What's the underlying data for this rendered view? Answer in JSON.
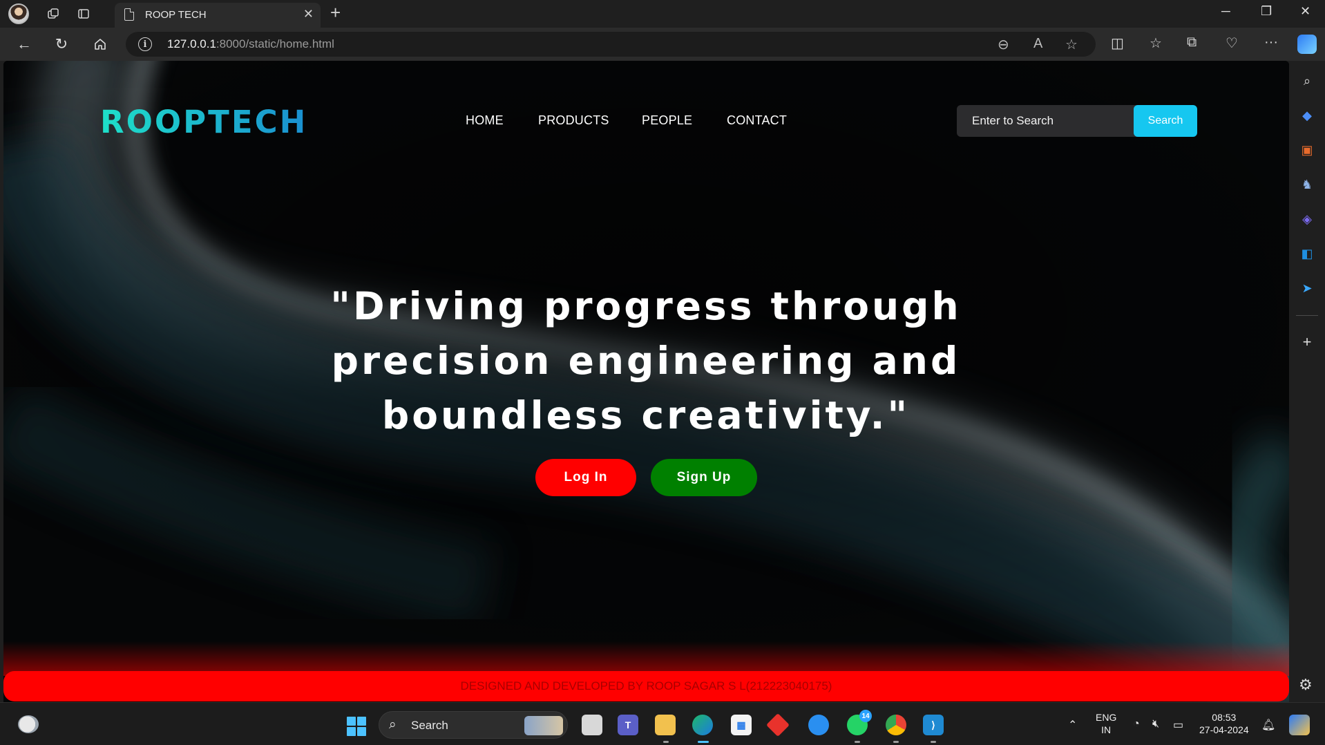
{
  "browser": {
    "tab_title": "ROOP TECH",
    "url_host": "127.0.0.1",
    "url_rest": ":8000/static/home.html"
  },
  "site": {
    "logo": "ROOPTECH",
    "nav": [
      "HOME",
      "PRODUCTS",
      "PEOPLE",
      "CONTACT"
    ],
    "search_placeholder": "Enter to Search",
    "search_button": "Search",
    "headline_lines": [
      "\"Driving progress through",
      "precision engineering and",
      "boundless creativity.\""
    ],
    "login_button": "Log In",
    "signup_button": "Sign Up",
    "footer": "DESIGNED AND DEVELOPED BY ROOP SAGAR S L(212223040175)",
    "colors": {
      "logo_gradient_start": "#1ee0c9",
      "logo_gradient_end": "#1a8fd0",
      "search_button": "#16c7f0",
      "login": "#ff0000",
      "signup": "#008000",
      "footer": "#ff0000"
    }
  },
  "taskbar": {
    "search_label": "Search",
    "whatsapp_badge": "14",
    "lang_top": "ENG",
    "lang_bottom": "IN",
    "time": "08:53",
    "date": "27-04-2024"
  }
}
